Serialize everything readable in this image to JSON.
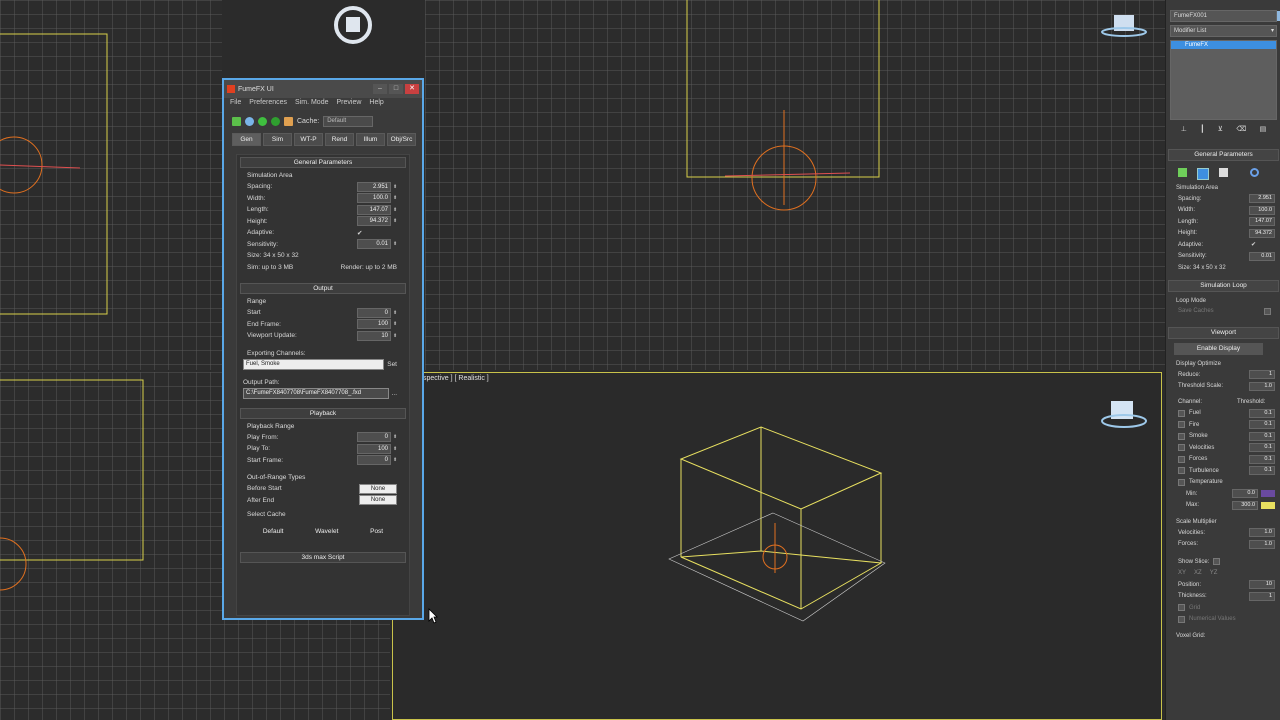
{
  "viewport_labels": {
    "perspective": "spective ] [ Realistic ]"
  },
  "fumefx": {
    "title": "FumeFX UI",
    "menu": [
      "File",
      "Preferences",
      "Sim. Mode",
      "Preview",
      "Help"
    ],
    "cache_label": "Cache:",
    "cache_value": "Default",
    "tabs": [
      "Gen",
      "Sim",
      "WT-P",
      "Rend",
      "Illum",
      "Obj/Src"
    ],
    "general": {
      "title": "General Parameters",
      "group": "Simulation Area",
      "rows": [
        {
          "label": "Spacing:",
          "value": "2.951"
        },
        {
          "label": "Width:",
          "value": "100.0"
        },
        {
          "label": "Length:",
          "value": "147.07"
        },
        {
          "label": "Height:",
          "value": "94.372"
        }
      ],
      "adaptive_label": "Adaptive:",
      "adaptive_value": "✔",
      "sensitivity_label": "Sensitivity:",
      "sensitivity_value": "0.01",
      "size": "Size: 34 x 50 x 32",
      "sim_mem": "Sim: up to 3 MB",
      "render_mem": "Render: up to 2 MB"
    },
    "output": {
      "title": "Output",
      "group": "Range",
      "rows": [
        {
          "label": "Start",
          "value": "0"
        },
        {
          "label": "End Frame:",
          "value": "100"
        },
        {
          "label": "Viewport Update:",
          "value": "10"
        }
      ],
      "channels_label": "Exporting Channels:",
      "channels_value": "Fuel, Smoke",
      "set_button": "Set",
      "path_label": "Output Path:",
      "path_value": "C:\\FumeFX8407708\\FumeFX8407708_.fxd",
      "browse": "..."
    },
    "playback": {
      "title": "Playback",
      "group": "Playback Range",
      "rows": [
        {
          "label": "Play From:",
          "value": "0"
        },
        {
          "label": "Play To:",
          "value": "100"
        },
        {
          "label": "Start Frame:",
          "value": "0"
        }
      ],
      "oor_group": "Out-of-Range Types",
      "before_label": "Before Start",
      "before_value": "None",
      "after_label": "After End",
      "after_value": "None",
      "select_cache": "Select Cache",
      "cache_buttons": [
        "Default",
        "Wavelet",
        "Post"
      ]
    },
    "script_rollout": "3ds max Script"
  },
  "command_panel": {
    "object_name": "FumeFX001",
    "modifier_list": "Modifier List",
    "stack_item": "FumeFX",
    "general_title": "General Parameters",
    "sim_area": "Simulation Area",
    "rows": [
      {
        "label": "Spacing:",
        "value": "2.951"
      },
      {
        "label": "Width:",
        "value": "100.0"
      },
      {
        "label": "Length:",
        "value": "147.07"
      },
      {
        "label": "Height:",
        "value": "94.372"
      }
    ],
    "adaptive_label": "Adaptive:",
    "adaptive_value": "✔",
    "sensitivity_label": "Sensitivity:",
    "sensitivity_value": "0.01",
    "size": "Size: 34 x 50 x 32",
    "sim_loop": "Simulation Loop",
    "loop_mode": "Loop Mode",
    "save_caches": "Save Caches",
    "viewport_title": "Viewport",
    "enable_display": "Enable Display",
    "display_optimize": "Display Optimize",
    "reduce_label": "Reduce:",
    "reduce_value": "1",
    "threshold_scale_label": "Threshold Scale:",
    "threshold_scale_value": "1.0",
    "channel_hdr": "Channel:",
    "threshold_hdr": "Threshold:",
    "channels": [
      {
        "label": "Fuel",
        "value": "0.1"
      },
      {
        "label": "Fire",
        "value": "0.1"
      },
      {
        "label": "Smoke",
        "value": "0.1"
      },
      {
        "label": "Velocities",
        "value": "0.1"
      },
      {
        "label": "Forces",
        "value": "0.1"
      },
      {
        "label": "Turbulence",
        "value": "0.1"
      },
      {
        "label": "Temperature",
        "value": ""
      }
    ],
    "min_label": "Min:",
    "min_value": "0.0",
    "max_label": "Max:",
    "max_value": "300.0",
    "scale_mult": "Scale Multiplier",
    "vel_label": "Velocities:",
    "vel_value": "1.0",
    "forces_label": "Forces:",
    "forces_value": "1.0",
    "show_slice": "Show Slice:",
    "slice_axes": [
      "XY",
      "XZ",
      "YZ"
    ],
    "position_label": "Position:",
    "position_value": "10",
    "thickness_label": "Thickness:",
    "thickness_value": "1",
    "grid_label": "Grid",
    "numerical_label": "Numerical Values",
    "voxel_grid": "Voxel Grid:"
  },
  "colors": {
    "window_border": "#5aa8e8",
    "grid": "#5a5a5a",
    "wireframe": "#e8e060",
    "helper": "#e07020"
  }
}
